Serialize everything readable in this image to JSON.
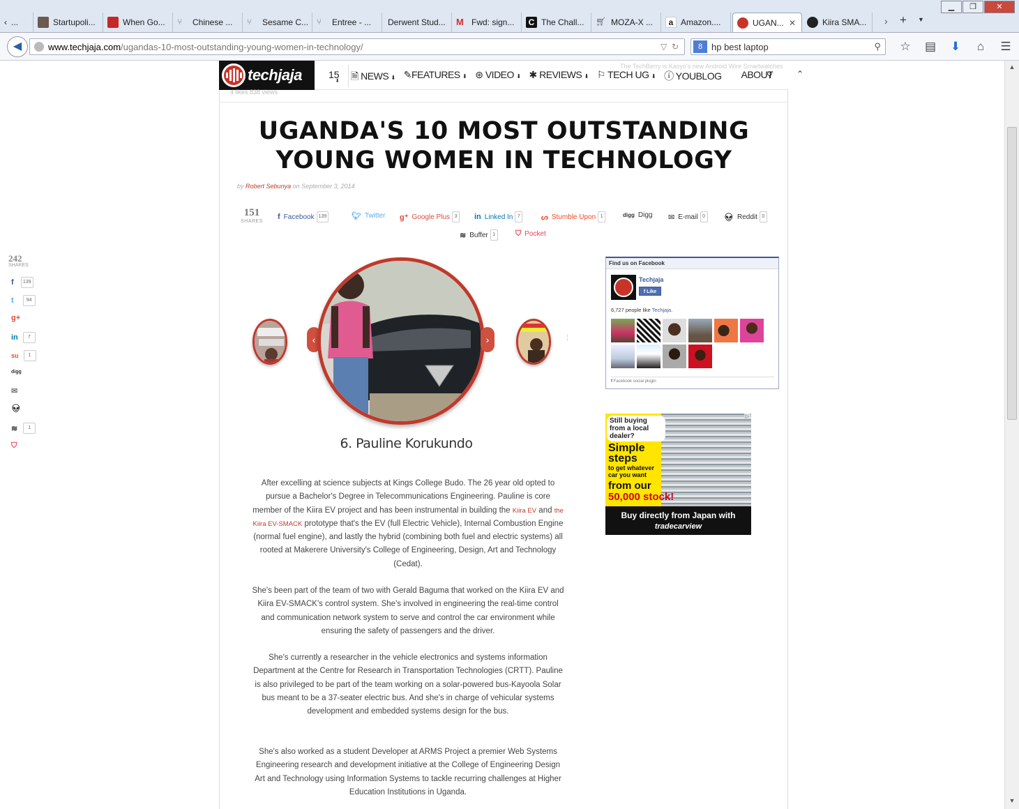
{
  "tabs": [
    {
      "label": "...",
      "favicon": "prev-arrow-icon"
    },
    {
      "label": "Startupoli...",
      "favicon": "avatar-icon"
    },
    {
      "label": "When Go...",
      "favicon": "grid-icon"
    },
    {
      "label": "Chinese ...",
      "favicon": "fork-icon"
    },
    {
      "label": "Sesame C...",
      "favicon": "fork-icon"
    },
    {
      "label": "Entree - ...",
      "favicon": "fork-icon"
    },
    {
      "label": "Derwent Stud...",
      "favicon": "blank-icon"
    },
    {
      "label": "Fwd: sign...",
      "favicon": "gmail-icon"
    },
    {
      "label": "The Chall...",
      "favicon": "c-icon"
    },
    {
      "label": "MOZA-X ...",
      "favicon": "cart-icon"
    },
    {
      "label": "Amazon....",
      "favicon": "amazon-icon"
    },
    {
      "label": "UGAN...",
      "favicon": "techjaja-icon",
      "active": true
    },
    {
      "label": "Kiira SMA...",
      "favicon": "circle-icon"
    }
  ],
  "url": {
    "host": "www.techjaja.com",
    "path": "/ugandas-10-most-outstanding-young-women-in-technology/"
  },
  "search": {
    "engine": "8",
    "query": "hp best laptop"
  },
  "site": {
    "logo_text": "techjaja",
    "nav_number": "15",
    "nav": [
      "NEWS",
      "FEATURES",
      "VIDEO",
      "REVIEWS",
      "TECH UG",
      "YOUBLOG",
      "ABOUT"
    ],
    "ghost_text": "The TechBerry is Kasyo's new Android Wire Smartwatches",
    "faded_meta": "4 likes   838 views"
  },
  "article": {
    "title": "UGANDA'S 10 MOST OUTSTANDING YOUNG WOMEN IN TECHNOLOGY",
    "byline_prefix": "by",
    "author": "Robert Sebunya",
    "date": "on September 3, 2014",
    "caption": "6. Pauline Korukundo",
    "paragraphs": [
      {
        "before": "After excelling at science subjects at Kings College Budo. The 26 year old opted to pursue a Bachelor's Degree in Telecommunications Engineering. Pauline is core member of the Kiira EV project and has been instrumental in building the ",
        "link1": "Kiira EV",
        "mid": " and ",
        "link2": "the Kiira EV-SMACK",
        "after": " prototype that's the EV (full Electric Vehicle), Internal Combustion Engine (normal fuel engine), and lastly the hybrid (combining both fuel and electric systems) all rooted at Makerere University's College of Engineering, Design, Art and Technology (Cedat)."
      },
      {
        "text": "She's been part of the team of two with Gerald Baguma that worked on the Kiira EV and Kiira EV-SMACK's control system. She's involved in engineering the real-time control and communication network system to serve and control the car environment while ensuring the safety of passengers and the driver."
      },
      {
        "text": "She's currently a researcher in the vehicle electronics and systems information Department at the Centre for Research in Transportation Technologies (CRTT). Pauline is also privileged to be part of the team working on a solar-powered bus-Kayoola Solar bus meant to be a 37-seater electric bus. And she's in charge of vehicular systems development and embedded systems design for the bus."
      },
      {
        "text": "She's also worked as a student Developer at ARMS Project a premier Web Systems Engineering research and development initiative at the College of Engineering Design Art and Technology using Information Systems to tackle recurring challenges at Higher Education Institutions in Uganda."
      }
    ]
  },
  "share": {
    "count": "151",
    "label": "SHARES",
    "buttons": [
      {
        "name": "Facebook",
        "count": "139",
        "color": "#3b5998"
      },
      {
        "name": "Twitter",
        "count": "",
        "color": "#55acee"
      },
      {
        "name": "Google Plus",
        "count": "3",
        "color": "#dd4b39"
      },
      {
        "name": "Linked In",
        "count": "7",
        "color": "#0077b5"
      },
      {
        "name": "Stumble Upon",
        "count": "1",
        "color": "#eb4924"
      },
      {
        "name": "Digg",
        "count": "",
        "color": "#333"
      },
      {
        "name": "E-mail",
        "count": "0",
        "color": "#333"
      },
      {
        "name": "Reddit",
        "count": "0",
        "color": "#333"
      },
      {
        "name": "Buffer",
        "count": "1",
        "color": "#333"
      },
      {
        "name": "Pocket",
        "count": "",
        "color": "#ee4056"
      }
    ]
  },
  "side_share": {
    "count": "242",
    "label": "SHARES",
    "items": [
      {
        "icon": "f",
        "count": "139",
        "color": "#3b5998"
      },
      {
        "icon": "t",
        "count": "94",
        "color": "#55acee"
      },
      {
        "icon": "g+",
        "count": "",
        "color": "#dd4b39"
      },
      {
        "icon": "in",
        "count": "7",
        "color": "#0077b5"
      },
      {
        "icon": "su",
        "count": "1",
        "color": "#eb4924"
      },
      {
        "icon": "digg",
        "count": "",
        "color": "#333"
      },
      {
        "icon": "✉",
        "count": "",
        "color": "#777"
      },
      {
        "icon": "r",
        "count": "",
        "color": "#333"
      },
      {
        "icon": "≋",
        "count": "1",
        "color": "#333"
      },
      {
        "icon": "p",
        "count": "",
        "color": "#ee4056"
      }
    ]
  },
  "facebook_widget": {
    "header": "Find us on Facebook",
    "page_name": "Techjaja",
    "like_label": "Like",
    "count_text": "6,727 people like",
    "count_link": "Techjaja.",
    "footer": "Facebook social plugin"
  },
  "ad": {
    "question": "Still buying from a local dealer?",
    "headline": "Simple steps",
    "sub": "to get whatever car you want",
    "from": "from our",
    "stock": "50,000 stock!",
    "bottom": "Buy directly from Japan with",
    "brand": "tradecarview"
  }
}
